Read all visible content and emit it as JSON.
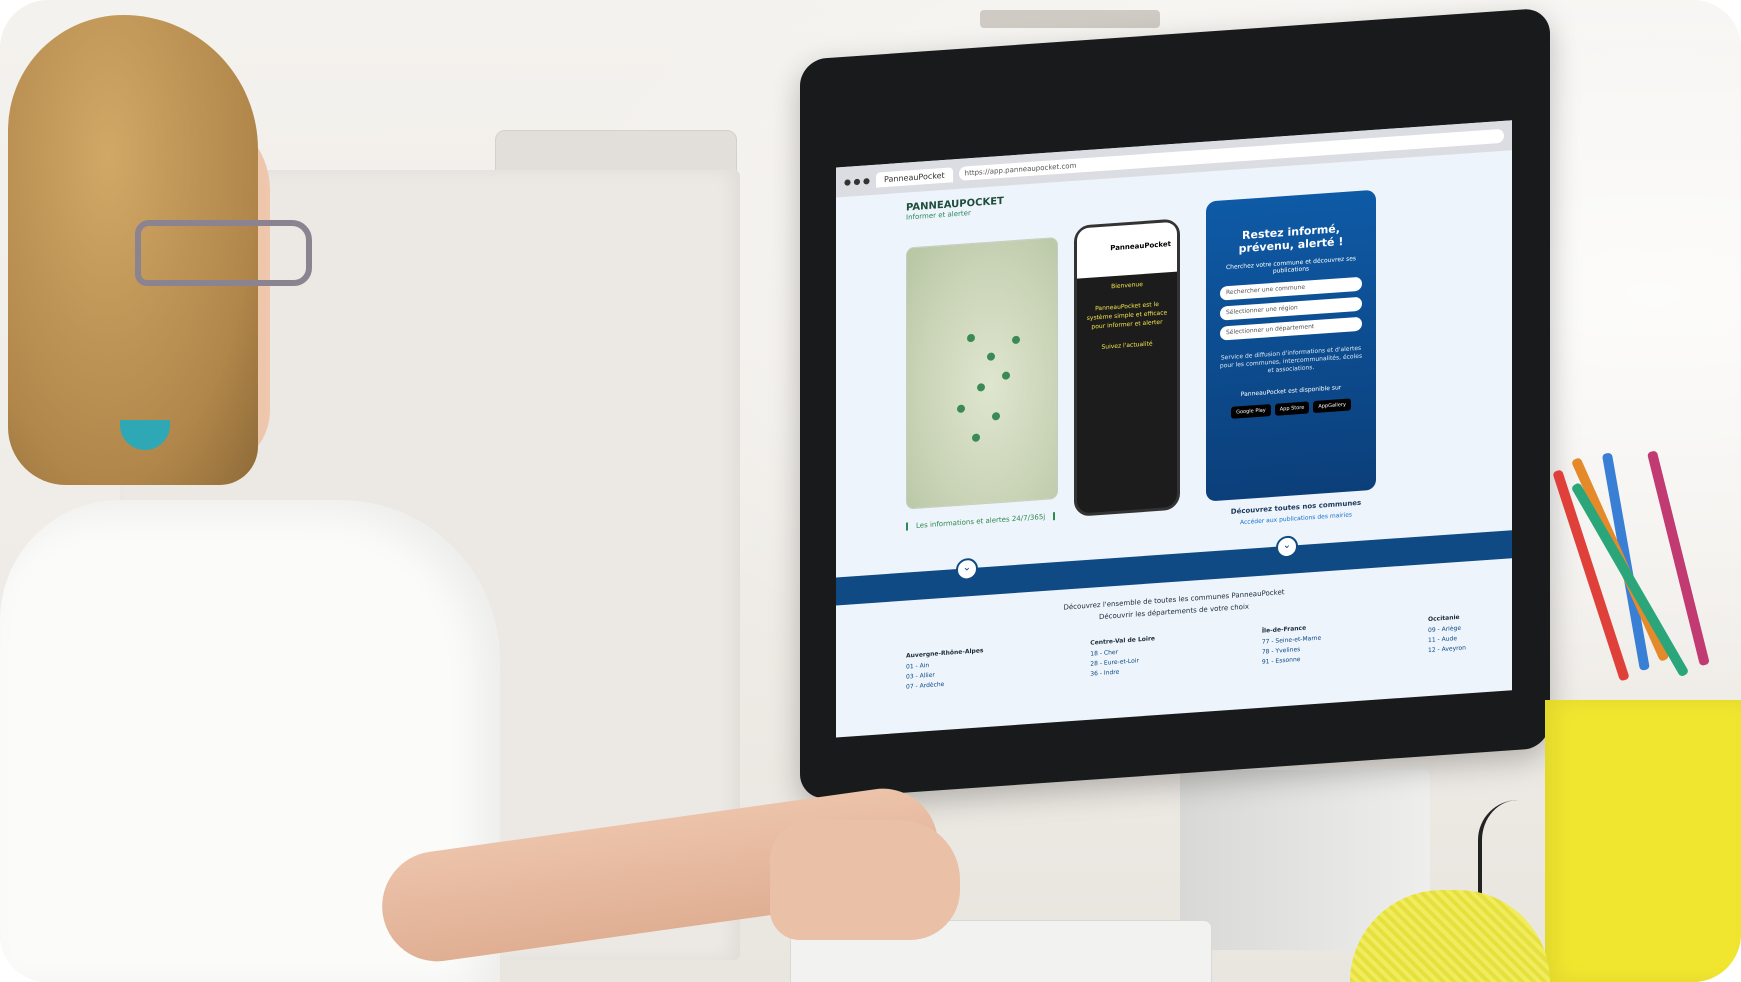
{
  "scene": "woman-at-computer",
  "browser": {
    "tab_label": "PanneauPocket",
    "url": "https://app.panneaupocket.com"
  },
  "site": {
    "logo_title": "PANNEAUPOCKET",
    "logo_subtitle": "Informer et alerter",
    "map_note": "Les informations et alertes 24/7/365j",
    "phone_header": "PanneauPocket",
    "phone_lines": [
      "Bienvenue",
      "PanneauPocket est le système simple et efficace pour informer et alerter",
      "Suivez l'actualité"
    ],
    "panel_title": "Restez informé, prévenu, alerté !",
    "panel_subtitle": "Cherchez votre commune et découvrez ses publications",
    "selects": [
      "Rechercher une commune",
      "Sélectionner une région",
      "Sélectionner un département"
    ],
    "panel_description": "Service de diffusion d'informations et d'alertes pour les communes, intercommunalités, écoles et associations.",
    "store_label": "PanneauPocket est disponible sur",
    "stores": [
      "Google Play",
      "App Store",
      "AppGallery"
    ],
    "foot_title": "Découvrez toutes nos communes",
    "foot_link": "Accéder aux publications des mairies",
    "bottom_line1": "Découvrez l'ensemble de toutes les communes PanneauPocket",
    "bottom_line2": "Découvrir les départements de votre choix",
    "regions": [
      {
        "name": "Auvergne-Rhône-Alpes",
        "items": [
          "01 - Ain",
          "03 - Allier",
          "07 - Ardèche"
        ]
      },
      {
        "name": "Centre-Val de Loire",
        "items": [
          "18 - Cher",
          "28 - Eure-et-Loir",
          "36 - Indre"
        ]
      },
      {
        "name": "Île-de-France",
        "items": [
          "77 - Seine-et-Marne",
          "78 - Yvelines",
          "91 - Essonne"
        ]
      },
      {
        "name": "Occitanie",
        "items": [
          "09 - Ariège",
          "11 - Aude",
          "12 - Aveyron"
        ]
      }
    ]
  },
  "colors": {
    "brand_blue": "#0f4a84",
    "brand_green": "#2d8a4e",
    "phone_text": "#f3e34b",
    "holder_yellow": "#f1e62f"
  }
}
